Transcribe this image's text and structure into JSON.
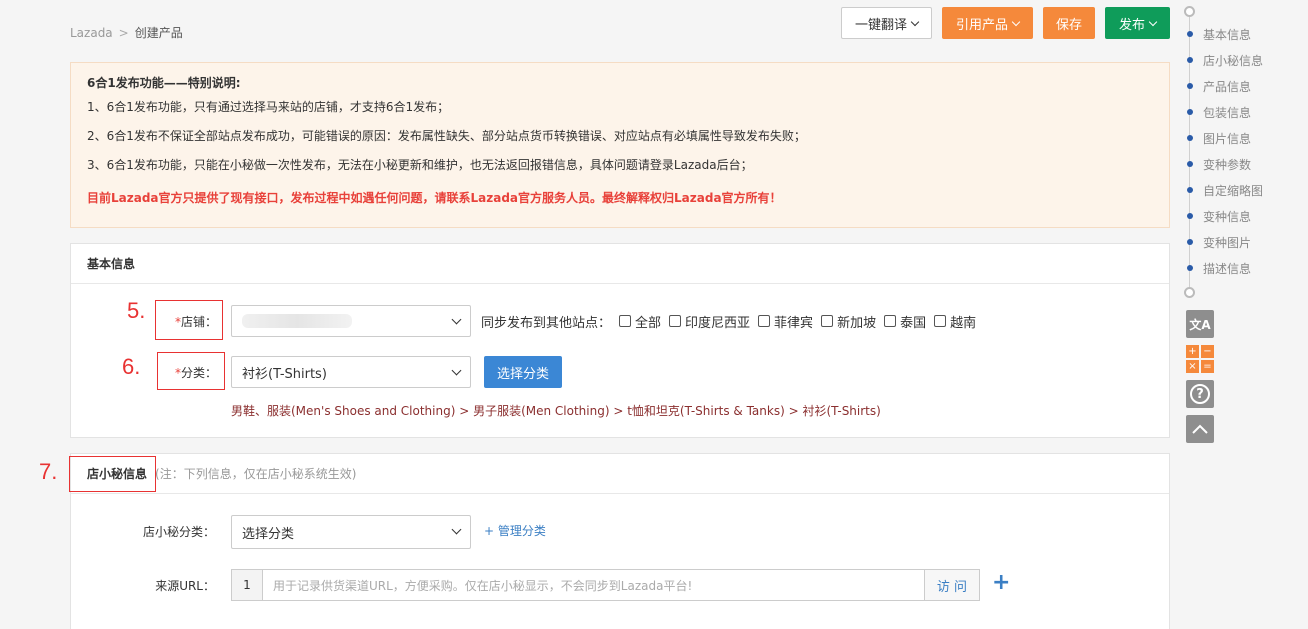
{
  "breadcrumb": {
    "root": "Lazada",
    "sep": ">",
    "current": "创建产品"
  },
  "actions": {
    "translate": "一键翻译",
    "import": "引用产品",
    "save": "保存",
    "publish": "发布"
  },
  "notice": {
    "title": "6合1发布功能——特别说明:",
    "line1": "1、6合1发布功能，只有通过选择马来站的店铺，才支持6合1发布；",
    "line2": "2、6合1发布不保证全部站点发布成功，可能错误的原因：发布属性缺失、部分站点货币转换错误、对应站点有必填属性导致发布失败；",
    "line3": "3、6合1发布功能，只能在小秘做一次性发布，无法在小秘更新和维护，也无法返回报错信息，具体问题请登录Lazada后台；",
    "warning": "目前Lazada官方只提供了现有接口，发布过程中如遇任何问题，请联系Lazada官方服务人员。最终解释权归Lazada官方所有！"
  },
  "basic": {
    "title": "基本信息",
    "store_label": "店铺：",
    "required_mark": "*",
    "sync_label": "同步发布到其他站点：",
    "sites": [
      "全部",
      "印度尼西亚",
      "菲律宾",
      "新加坡",
      "泰国",
      "越南"
    ],
    "category_label": "分类：",
    "category_value": "衬衫(T-Shirts)",
    "choose_category": "选择分类",
    "category_path": "男鞋、服装(Men's Shoes and Clothing) > 男子服装(Men Clothing) > t恤和坦克(T-Shirts & Tanks) > 衬衫(T-Shirts)"
  },
  "annotations": {
    "step5": "5.",
    "step6": "6.",
    "step7": "7."
  },
  "xiaomi": {
    "title": "店小秘信息",
    "hint": "(注：下列信息，仅在店小秘系统生效)",
    "category_label": "店小秘分类：",
    "category_value": "选择分类",
    "manage": "+ 管理分类",
    "url_label": "来源URL：",
    "url_index": "1",
    "url_placeholder": "用于记录供货渠道URL，方便采购。仅在店小秘显示，不会同步到Lazada平台!",
    "visit": "访 问",
    "add": "+"
  },
  "nav": [
    "基本信息",
    "店小秘信息",
    "产品信息",
    "包装信息",
    "图片信息",
    "变种参数",
    "自定缩略图",
    "变种信息",
    "变种图片",
    "描述信息"
  ],
  "tools": {
    "translate_glyph": "文A",
    "help_glyph": "?",
    "calc": [
      "+",
      "−",
      "×",
      "="
    ]
  },
  "colors": {
    "orange": "#f5893b",
    "green": "#0f9c5a",
    "blue": "#3b87d5",
    "red": "#e83232"
  }
}
